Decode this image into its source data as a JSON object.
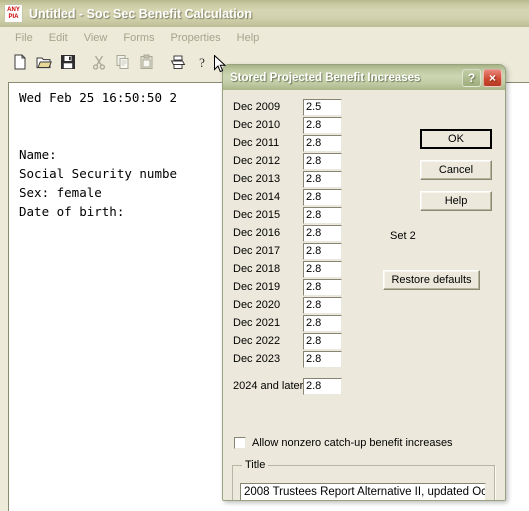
{
  "app": {
    "icon_line1": "ANY",
    "icon_line2": "PIA",
    "icon_name": "anypia-logo-icon",
    "title": "Untitled - Soc Sec Benefit Calculation",
    "menu": [
      {
        "label": "File"
      },
      {
        "label": "Edit"
      },
      {
        "label": "View"
      },
      {
        "label": "Forms"
      },
      {
        "label": "Properties"
      },
      {
        "label": "Help"
      }
    ],
    "toolbar": [
      {
        "name": "new-document-icon",
        "label": "New"
      },
      {
        "name": "open-folder-icon",
        "label": "Open"
      },
      {
        "name": "save-disk-icon",
        "label": "Save"
      },
      {
        "name": "cut-scissors-icon",
        "label": "Cut"
      },
      {
        "name": "copy-icon",
        "label": "Copy"
      },
      {
        "name": "paste-clipboard-icon",
        "label": "Paste"
      },
      {
        "name": "print-icon",
        "label": "Print"
      },
      {
        "name": "help-question-icon",
        "label": "Help"
      }
    ],
    "document_text": "Wed Feb 25 16:50:50 2\n\n\nName:\nSocial Security numbe\nSex: female\nDate of birth:"
  },
  "dialog": {
    "title": "Stored Projected Benefit Increases",
    "help_button_label": "?",
    "close_button_label": "×",
    "rows": [
      {
        "label": "Dec 2009",
        "value": "2.5"
      },
      {
        "label": "Dec 2010",
        "value": "2.8"
      },
      {
        "label": "Dec 2011",
        "value": "2.8"
      },
      {
        "label": "Dec 2012",
        "value": "2.8"
      },
      {
        "label": "Dec 2013",
        "value": "2.8"
      },
      {
        "label": "Dec 2014",
        "value": "2.8"
      },
      {
        "label": "Dec 2015",
        "value": "2.8"
      },
      {
        "label": "Dec 2016",
        "value": "2.8"
      },
      {
        "label": "Dec 2017",
        "value": "2.8"
      },
      {
        "label": "Dec 2018",
        "value": "2.8"
      },
      {
        "label": "Dec 2019",
        "value": "2.8"
      },
      {
        "label": "Dec 2020",
        "value": "2.8"
      },
      {
        "label": "Dec 2021",
        "value": "2.8"
      },
      {
        "label": "Dec 2022",
        "value": "2.8"
      },
      {
        "label": "Dec 2023",
        "value": "2.8"
      }
    ],
    "later_row": {
      "label": "2024 and later",
      "value": "2.8"
    },
    "buttons": {
      "ok": "OK",
      "cancel": "Cancel",
      "help": "Help",
      "restore_defaults": "Restore defaults"
    },
    "set_label": "Set 2",
    "checkbox": {
      "label": "Allow nonzero catch-up benefit increases",
      "checked": false
    },
    "title_group": {
      "legend": "Title",
      "value": "2008 Trustees Report Alternative II, updated Oc"
    }
  },
  "colors": {
    "app_titlebar": "#cdcdaa",
    "dialog_titlebar": "#bcc79e",
    "dialog_face": "#ece9dc",
    "menubar": "#edead9",
    "logo_red": "#cc0000",
    "close_button": "#cf4a32",
    "disabled_menu_text": "#a5a58c"
  }
}
